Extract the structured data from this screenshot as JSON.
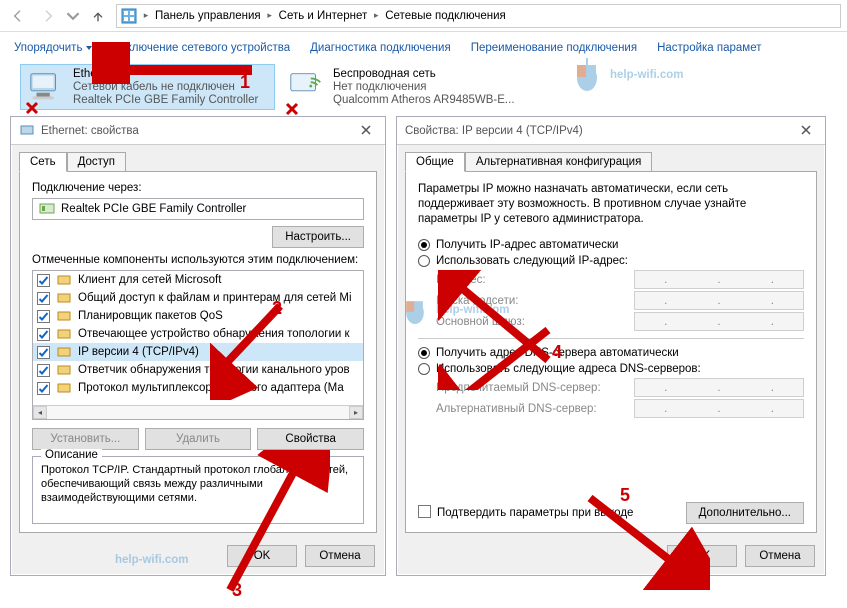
{
  "breadcrumb": {
    "p1": "Панель управления",
    "p2": "Сеть и Интернет",
    "p3": "Сетевые подключения"
  },
  "toolbar": {
    "organize": "Упорядочить",
    "disable": "Отключение сетевого устройства",
    "diag": "Диагностика подключения",
    "rename": "Переименование подключения",
    "settings": "Настройка парамет"
  },
  "conn": {
    "ethernet": {
      "title": "Ethernet",
      "status": "Сетевой кабель не подключен",
      "device": "Realtek PCIe GBE Family Controller"
    },
    "wifi": {
      "title": "Беспроводная сеть",
      "status": "Нет подключения",
      "device": "Qualcomm Atheros AR9485WB-E..."
    }
  },
  "dlgL": {
    "title": "Ethernet: свойства",
    "tab_net": "Сеть",
    "tab_access": "Доступ",
    "connect_via": "Подключение через:",
    "adapter": "Realtek PCIe GBE Family Controller",
    "configure": "Настроить...",
    "components_label": "Отмеченные компоненты используются этим подключением:",
    "components": [
      "Клиент для сетей Microsoft",
      "Общий доступ к файлам и принтерам для сетей Mi",
      "Планировщик пакетов QoS",
      "Отвечающее устройство обнаружения топологии к",
      "IP версии 4 (TCP/IPv4)",
      "Ответчик обнаружения топологии канального уров",
      "Протокол мультиплексора сетевого адаптера (Ма"
    ],
    "install": "Установить...",
    "remove": "Удалить",
    "props": "Свойства",
    "desc_h": "Описание",
    "desc": "Протокол TCP/IP. Стандартный протокол глобальных сетей, обеспечивающий связь между различными взаимодействующими сетями.",
    "ok": "OK",
    "cancel": "Отмена"
  },
  "dlgR": {
    "title": "Свойства: IP версии 4 (TCP/IPv4)",
    "tab_general": "Общие",
    "tab_alt": "Альтернативная конфигурация",
    "intro": "Параметры IP можно назначать автоматически, если сеть поддерживает эту возможность. В противном случае узнайте параметры IP у сетевого администратора.",
    "ip_auto": "Получить IP-адрес автоматически",
    "ip_manual": "Использовать следующий IP-адрес:",
    "ip_addr": "IP-адрес:",
    "mask": "Маска подсети:",
    "gateway": "Основной шлюз:",
    "dns_auto": "Получить адрес DNS-сервера автоматически",
    "dns_manual": "Использовать следующие адреса DNS-серверов:",
    "dns_pref": "Предпочитаемый DNS-сервер:",
    "dns_alt": "Альтернативный DNS-сервер:",
    "confirm": "Подтвердить параметры при выходе",
    "advanced": "Дополнительно...",
    "ok": "OK",
    "cancel": "Отмена"
  },
  "watermark": "help-wifi.com",
  "steps": {
    "s1": "1",
    "s2": "2",
    "s3": "3",
    "s4": "4",
    "s5": "5"
  }
}
